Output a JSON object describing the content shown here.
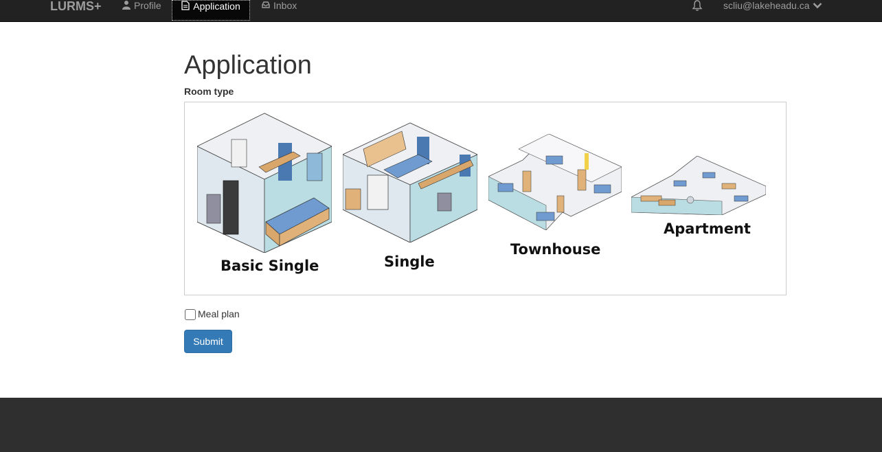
{
  "nav": {
    "brand": "LURMS+",
    "items": [
      {
        "label": "Profile",
        "icon": "user-icon"
      },
      {
        "label": "Application",
        "icon": "document-icon",
        "active": true
      },
      {
        "label": "Inbox",
        "icon": "inbox-icon"
      }
    ],
    "user_email": "scliu@lakeheadu.ca"
  },
  "main": {
    "title": "Application",
    "room_type_label": "Room type",
    "rooms": [
      {
        "caption": "Basic Single"
      },
      {
        "caption": "Single"
      },
      {
        "caption": "Townhouse"
      },
      {
        "caption": "Apartment"
      }
    ],
    "meal_plan_label": "Meal plan",
    "meal_plan_checked": false,
    "submit_label": "Submit"
  },
  "colors": {
    "navbar": "#222222",
    "primary_button": "#337ab7",
    "footer": "#2f2f2f"
  }
}
